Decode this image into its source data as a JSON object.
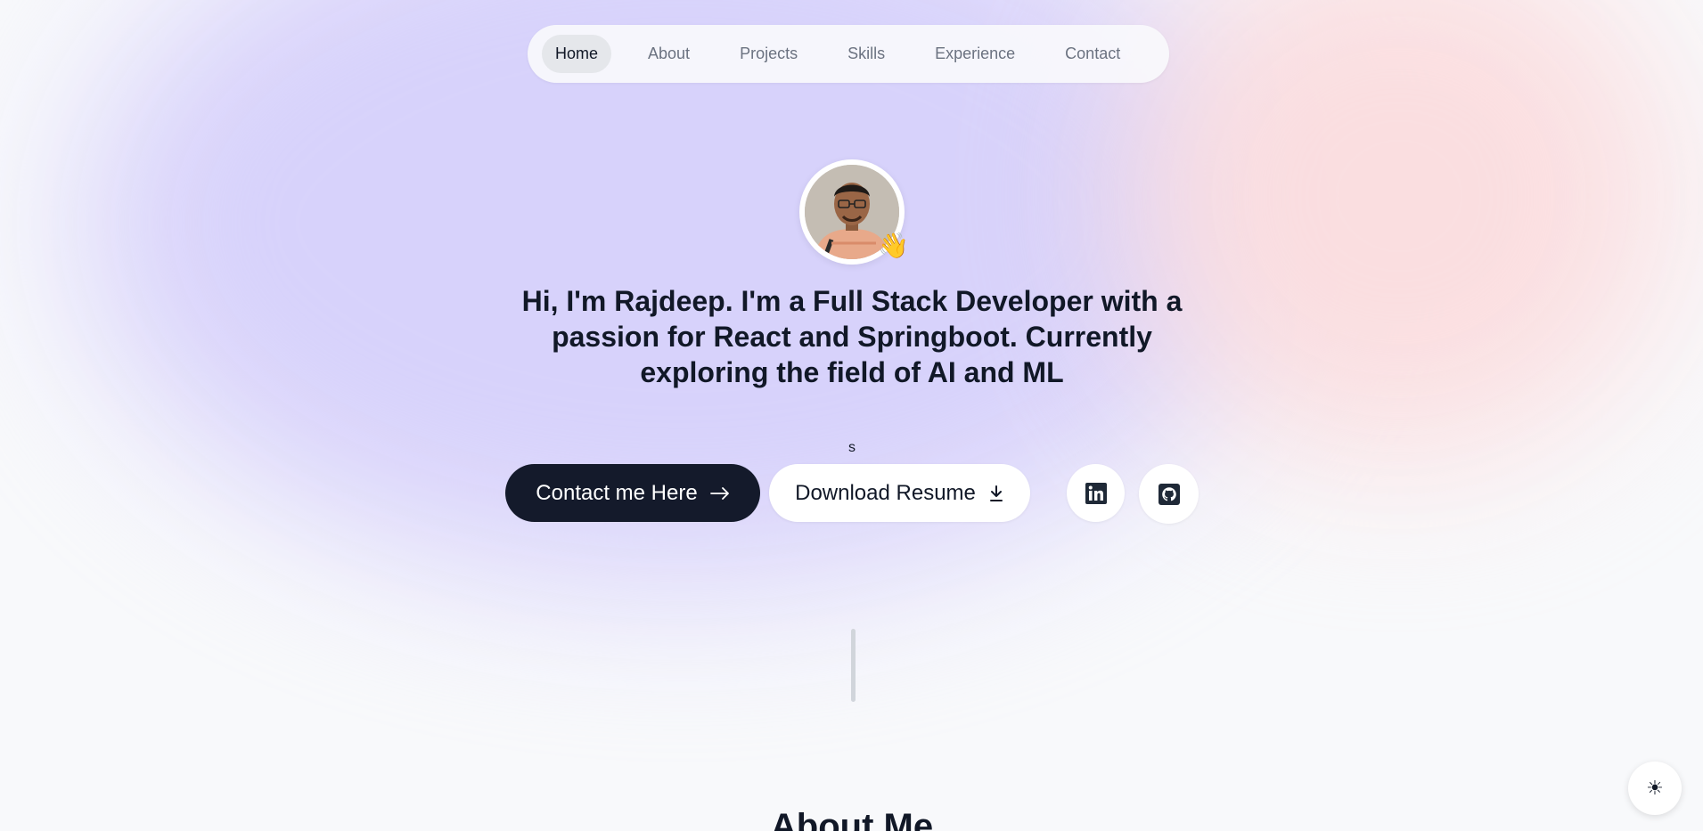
{
  "nav": {
    "items": [
      {
        "label": "Home",
        "active": true
      },
      {
        "label": "About",
        "active": false
      },
      {
        "label": "Projects",
        "active": false
      },
      {
        "label": "Skills",
        "active": false
      },
      {
        "label": "Experience",
        "active": false
      },
      {
        "label": "Contact",
        "active": false
      }
    ]
  },
  "hero": {
    "avatar_badge": "waving-hand-emoji",
    "name_intro": "Hi, I'm Rajdeep.",
    "tagline": " I'm a Full Stack Developer with a passion for React and Springboot. Currently exploring the field of AI and ML",
    "stray_text": "s",
    "contact_label": "Contact me Here",
    "resume_label": "Download Resume",
    "social": [
      {
        "name": "linkedin-icon"
      },
      {
        "name": "github-icon"
      }
    ]
  },
  "about": {
    "title": "About Me"
  },
  "theme_toggle": {
    "icon": "sun-icon",
    "glyph": "☀"
  },
  "colors": {
    "dark_button": "#141a2b",
    "purple_glow": "#d6d0fb",
    "pink_glow": "#fbdddf",
    "page_bg": "#f8f9fb"
  }
}
